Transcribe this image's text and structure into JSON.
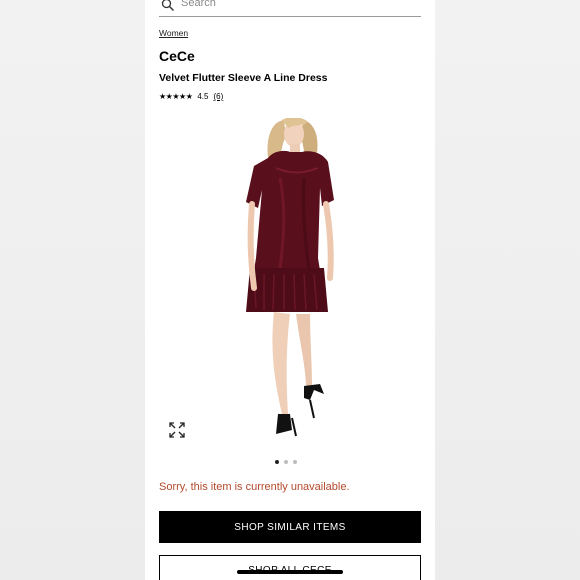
{
  "search": {
    "placeholder": "Search"
  },
  "breadcrumb": "Women",
  "product": {
    "brand": "CeCe",
    "title": "Velvet Flutter Sleeve A Line Dress",
    "stars": "★★★★★",
    "rating": "4.5",
    "review_count": "(6)"
  },
  "gallery": {
    "image_count": 3,
    "active_index": 0
  },
  "status": {
    "message": "Sorry, this item is currently unavailable.",
    "color": "#b34a2c"
  },
  "actions": {
    "shop_similar": "SHOP SIMILAR ITEMS",
    "shop_all": "SHOP ALL CECE"
  },
  "icons": {
    "search": "search-icon",
    "expand": "expand-icon"
  },
  "colors": {
    "dress": "#5a0f1c",
    "button": "#000000"
  }
}
